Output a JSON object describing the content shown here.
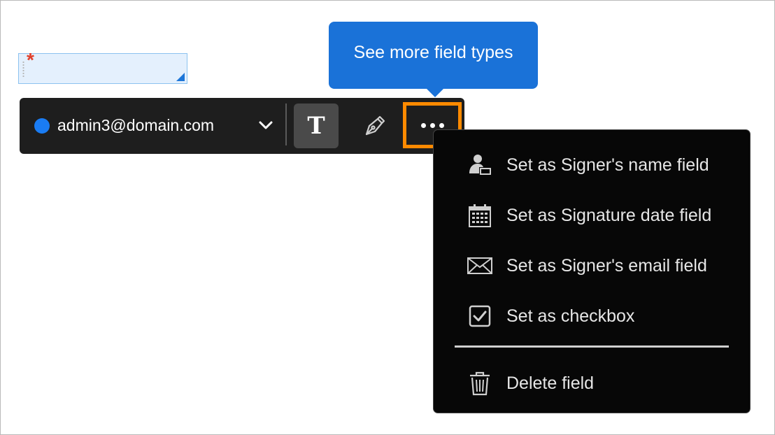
{
  "form_field": {
    "required_marker": "*"
  },
  "toolbar": {
    "assignee_email": "admin3@domain.com",
    "assignee_color": "#1a7cf3",
    "text_tool_label": "T"
  },
  "tooltip": {
    "text": "See more field types"
  },
  "menu": {
    "items": [
      {
        "label": "Set as Signer's name field",
        "icon": "signer-name-icon"
      },
      {
        "label": "Set as Signature date field",
        "icon": "calendar-icon"
      },
      {
        "label": "Set as Signer's email field",
        "icon": "envelope-icon"
      },
      {
        "label": "Set as checkbox",
        "icon": "checkbox-icon"
      },
      {
        "label": "Delete field",
        "icon": "trash-icon"
      }
    ]
  },
  "colors": {
    "highlight": "#ff8a00",
    "tooltip_bg": "#1a72d8",
    "menu_bg": "#070707",
    "field_bg": "#e4f0fd"
  }
}
